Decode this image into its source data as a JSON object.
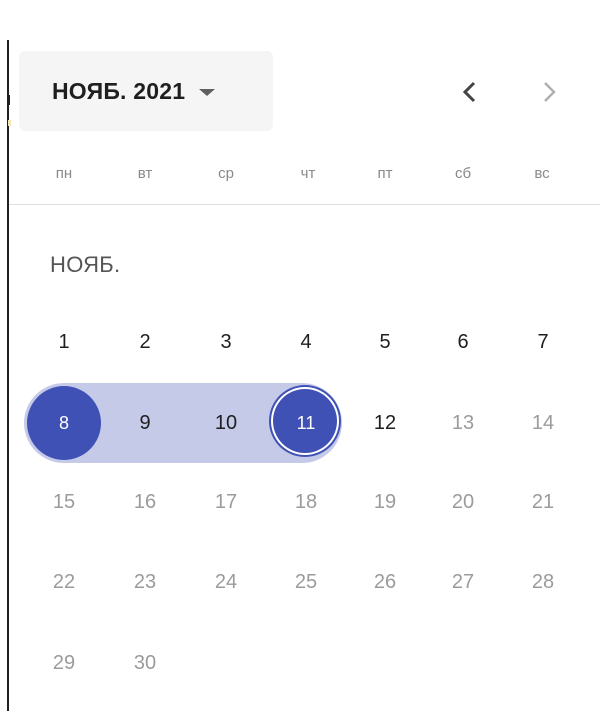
{
  "header": {
    "month_year_label": "НОЯБ. 2021",
    "caret_icon": "caret-down-icon",
    "prev_icon": "chevron-left-icon",
    "next_icon": "chevron-right-icon"
  },
  "weekdays": [
    "пн",
    "вт",
    "ср",
    "чт",
    "пт",
    "сб",
    "вс"
  ],
  "month_section_label": "НОЯБ.",
  "days": [
    {
      "label": "1",
      "state": "active"
    },
    {
      "label": "2",
      "state": "active"
    },
    {
      "label": "3",
      "state": "active"
    },
    {
      "label": "4",
      "state": "active"
    },
    {
      "label": "5",
      "state": "active"
    },
    {
      "label": "6",
      "state": "active"
    },
    {
      "label": "7",
      "state": "active"
    },
    {
      "label": "8",
      "state": "range-start"
    },
    {
      "label": "9",
      "state": "in-range"
    },
    {
      "label": "10",
      "state": "in-range"
    },
    {
      "label": "11",
      "state": "range-end"
    },
    {
      "label": "12",
      "state": "active"
    },
    {
      "label": "13",
      "state": "muted"
    },
    {
      "label": "14",
      "state": "muted"
    },
    {
      "label": "15",
      "state": "muted"
    },
    {
      "label": "16",
      "state": "muted"
    },
    {
      "label": "17",
      "state": "muted"
    },
    {
      "label": "18",
      "state": "muted"
    },
    {
      "label": "19",
      "state": "muted"
    },
    {
      "label": "20",
      "state": "muted"
    },
    {
      "label": "21",
      "state": "muted"
    },
    {
      "label": "22",
      "state": "muted"
    },
    {
      "label": "23",
      "state": "muted"
    },
    {
      "label": "24",
      "state": "muted"
    },
    {
      "label": "25",
      "state": "muted"
    },
    {
      "label": "26",
      "state": "muted"
    },
    {
      "label": "27",
      "state": "muted"
    },
    {
      "label": "28",
      "state": "muted"
    },
    {
      "label": "29",
      "state": "muted"
    },
    {
      "label": "30",
      "state": "muted"
    }
  ],
  "colors": {
    "accent": "#3f51b5",
    "range_fill": "#c5cae9",
    "muted_text": "#9b9b9b",
    "active_text": "#1f1f1f"
  }
}
